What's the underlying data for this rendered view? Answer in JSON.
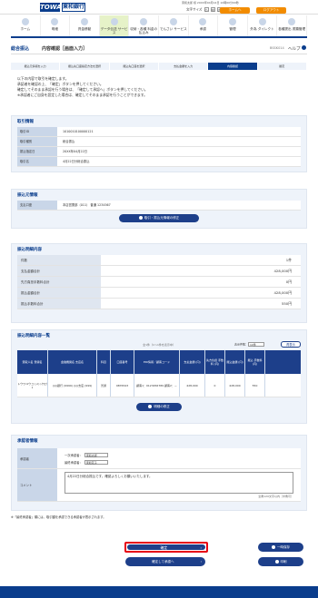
{
  "header": {
    "logo": "TOWA",
    "bank_name": "東和銀行",
    "user_info": "東和太郎 様 20XX年04月14日 10時00分00秒",
    "font_size_label": "文字サイズ",
    "font_sizes": [
      "小",
      "中",
      "大"
    ],
    "home_button": "ホームへ",
    "logout_button": "ログアウト"
  },
  "nav": [
    {
      "label": "ホーム",
      "active": false
    },
    {
      "label": "明細",
      "active": false
    },
    {
      "label": "資金移動",
      "active": false
    },
    {
      "label": "データ伝送\nサービス",
      "active": true
    },
    {
      "label": "収納・各種\n料金の払込み",
      "active": false
    },
    {
      "label": "でんさい\nサービス",
      "active": false
    },
    {
      "label": "承認",
      "active": false
    },
    {
      "label": "管理",
      "active": false
    },
    {
      "label": "外為\nダイレクト",
      "active": false
    },
    {
      "label": "各種提出\n書類管理",
      "active": false
    }
  ],
  "page": {
    "title_main": "総合振込",
    "title_sub": "内容確認［画面入力］",
    "page_code": "BSSK014",
    "help": "ヘルプ"
  },
  "steps": [
    "振込元情報を入力",
    "振込先口座指定方法を選択",
    "振込先口座を選択",
    "支払金額を入力",
    "内容確認",
    "確定"
  ],
  "intro": [
    "以下の内容で取引を確定します。",
    "承認者を確認の上、「確定」ボタンを押してください。",
    "確定してそのまま承認を行う場合は、「確定して承認へ」ボタンを押してください。",
    "※承認者にご自身を設定した場合は、確定してそのまま承認を行うことができます。"
  ],
  "transaction_info": {
    "title": "取引情報",
    "rows": [
      {
        "k": "取引ID",
        "v": "101001010000012​1"
      },
      {
        "k": "取引種別",
        "v": "総合振込"
      },
      {
        "k": "振込指定日",
        "v": "20XX年04月22日"
      },
      {
        "k": "取引名",
        "v": "4月22日分総合振込"
      }
    ]
  },
  "source_info": {
    "title": "振込元情報",
    "rows": [
      {
        "k": "支払口座",
        "v": "本店営業部（011） 普通 1234567"
      }
    ],
    "edit_button": "取引・振込元情報の修正"
  },
  "summary": {
    "title": "振込明細内容",
    "rows": [
      {
        "k": "件数",
        "v": "1件"
      },
      {
        "k": "支払金額合計",
        "v": "428,000円"
      },
      {
        "k": "先方負担手数料合計",
        "v": "0円"
      },
      {
        "k": "振込金額合計",
        "v": "428,000円"
      },
      {
        "k": "振込手数料合計",
        "v": "550円"
      }
    ]
  },
  "detail_list": {
    "title": "振込明細内容一覧",
    "range": "全1件（1～1件を表示中）",
    "per_page_label": "表示件数：",
    "per_page_value": "10件",
    "redisplay_button": "再表示",
    "headers": [
      "受取人名\n登録名",
      "金融機関名\n支店名",
      "科目",
      "口座番号",
      "EDI情報／顧客コード",
      "支払金額\n(円)",
      "先方負担\n手数料\n(円)",
      "振込金額\n(円)",
      "振込\n手数料\n(円)"
    ],
    "rows": [
      [
        "トウワユウコ (メ)\nﾄｳﾜﾕｳｺ",
        "◎◎銀行 (9999)\n◎◎支店 (999)",
        "普通",
        "9876543",
        "顧客1：0123456789\n顧客2：－",
        "428,000",
        "0",
        "428,000",
        "550"
      ]
    ],
    "edit_button": "明細の修正"
  },
  "approver": {
    "title": "承認者情報",
    "label_approver": "承認者",
    "first_label": "一次承認者：",
    "first_value": "東和太郎",
    "final_label": "最終承認者：",
    "final_value": "東和花子",
    "label_comment": "コメント",
    "comment": "4月22日分総合振込です。確認よろしくお願いいたします。",
    "char_count": "全角120文字以内［半角可］"
  },
  "note": "※「最終承認者」欄には、取引額を承認できる承認者が表示されます。",
  "actions": {
    "confirm": "確定",
    "confirm_and_approve": "確定して承認へ",
    "save_temp": "一時保存",
    "print": "印刷"
  }
}
